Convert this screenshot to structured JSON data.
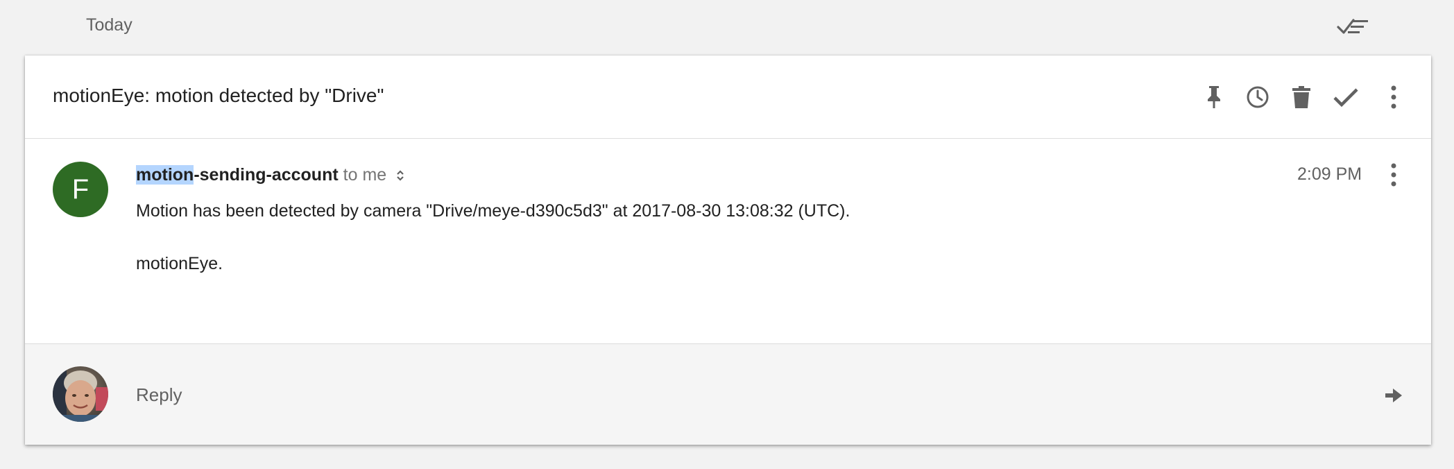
{
  "section": {
    "title": "Today",
    "sweep_icon": "sweep-done-icon"
  },
  "thread": {
    "subject": "motionEye: motion detected by \"Drive\"",
    "actions": [
      {
        "name": "pin",
        "icon": "pin-icon"
      },
      {
        "name": "snooze",
        "icon": "clock-icon"
      },
      {
        "name": "trash",
        "icon": "trash-icon"
      },
      {
        "name": "done",
        "icon": "check-icon"
      },
      {
        "name": "more",
        "icon": "more-vert-icon"
      }
    ]
  },
  "message": {
    "avatar_letter": "F",
    "avatar_color": "#2e6b24",
    "sender_highlight": "motion",
    "sender_rest": "-sending-account",
    "recipient": "to me",
    "time": "2:09 PM",
    "body_line1": "Motion has been detected by camera \"Drive/meye-d390c5d3\" at 2017-08-30 13:08:32 (UTC).",
    "body_line2": "motionEye."
  },
  "reply": {
    "label": "Reply",
    "send_icon": "arrow-right-icon"
  }
}
